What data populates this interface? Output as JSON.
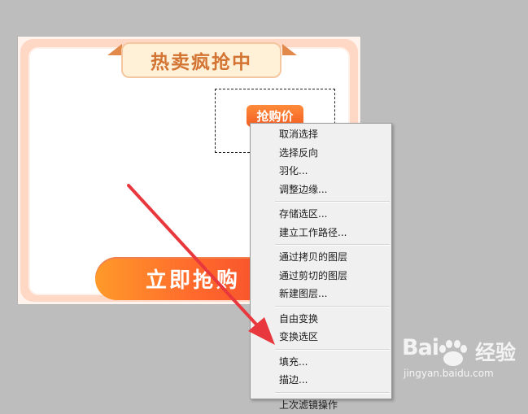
{
  "canvas": {
    "title": "热卖疯抢中",
    "price_tag": "抢购价",
    "buy_button": "立即抢购"
  },
  "context_menu": {
    "group1": [
      "取消选择",
      "选择反向",
      "羽化...",
      "调整边缘..."
    ],
    "group2": [
      "存储选区...",
      "建立工作路径..."
    ],
    "group3": [
      "通过拷贝的图层",
      "通过剪切的图层",
      "新建图层..."
    ],
    "group4": [
      "自由变换",
      "变换选区"
    ],
    "group5": [
      "填充...",
      "描边..."
    ],
    "group6": [
      "上次滤镜操作"
    ]
  },
  "watermark": {
    "brand_left": "Bai",
    "brand_right": "经验",
    "url": "jingyan.baidu.com"
  },
  "colors": {
    "workspace_bg": "#bdbdbd",
    "accent_orange": "#f25d22",
    "arrow_red": "#e8383d",
    "menu_bg": "#f0f0f0"
  },
  "icons": {
    "annotation": "red-arrow",
    "watermark_logo": "baidu-paw-icon"
  }
}
